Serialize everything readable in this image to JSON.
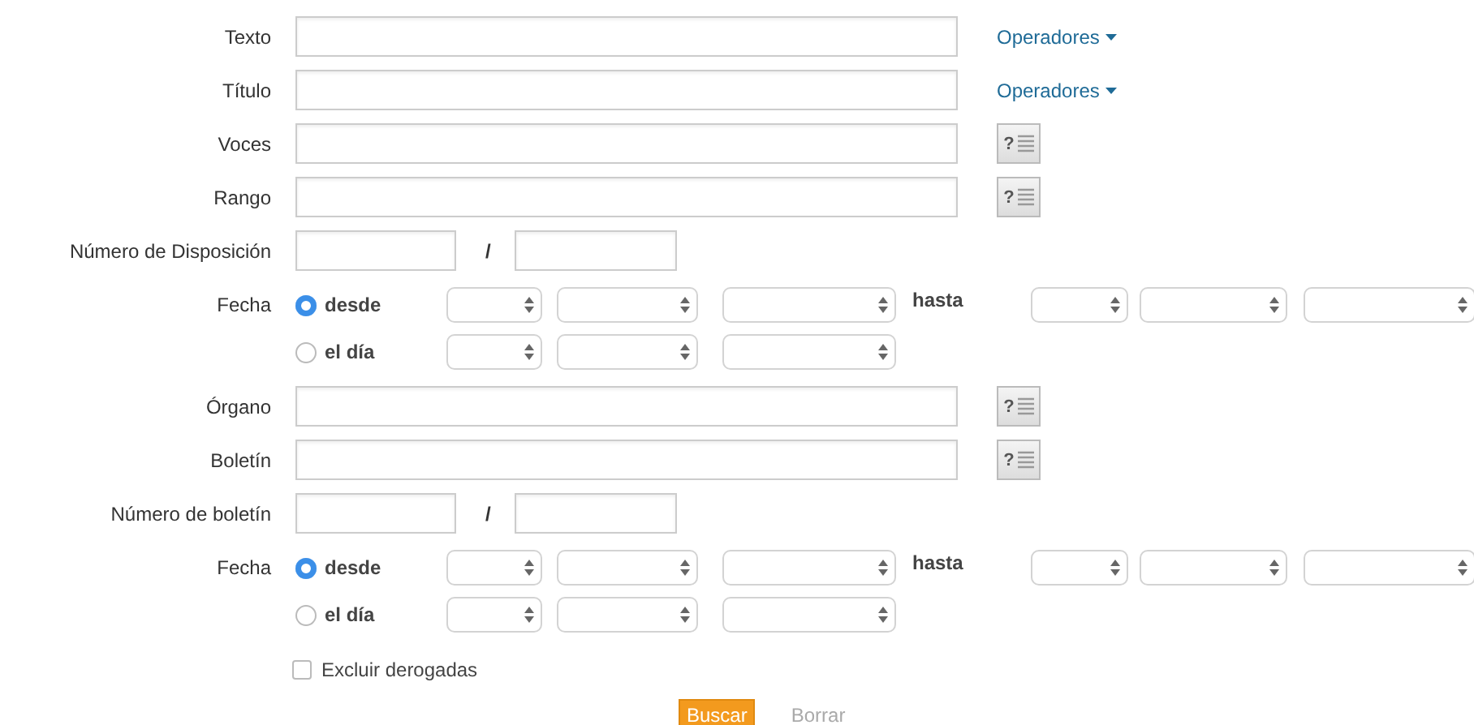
{
  "rows": [
    {
      "kind": "text",
      "label": "Texto",
      "aside": {
        "kind": "operators",
        "label": "Operadores"
      }
    },
    {
      "kind": "text",
      "label": "Título",
      "aside": {
        "kind": "operators",
        "label": "Operadores"
      }
    },
    {
      "kind": "text",
      "label": "Voces",
      "aside": {
        "kind": "help",
        "symbol": "?"
      }
    },
    {
      "kind": "text",
      "label": "Rango",
      "aside": {
        "kind": "help",
        "symbol": "?"
      }
    },
    {
      "kind": "number",
      "label": "Número de Disposición",
      "separator": "/"
    },
    {
      "kind": "date",
      "label": "Fecha",
      "until": "hasta",
      "options": [
        {
          "label": "desde",
          "selected": true
        },
        {
          "label": "el día",
          "selected": false
        }
      ]
    },
    {
      "kind": "text",
      "label": "Órgano",
      "aside": {
        "kind": "help",
        "symbol": "?"
      }
    },
    {
      "kind": "text",
      "label": "Boletín",
      "aside": {
        "kind": "help",
        "symbol": "?"
      }
    },
    {
      "kind": "number",
      "label": "Número de boletín",
      "separator": "/"
    },
    {
      "kind": "date",
      "label": "Fecha",
      "until": "hasta",
      "options": [
        {
          "label": "desde",
          "selected": true
        },
        {
          "label": "el día",
          "selected": false
        }
      ]
    }
  ],
  "exclude": {
    "label": "Excluir derogadas",
    "checked": false
  },
  "actions": [
    {
      "kind": "primary",
      "label": "Buscar"
    },
    {
      "kind": "plain",
      "label": "Borrar"
    }
  ]
}
